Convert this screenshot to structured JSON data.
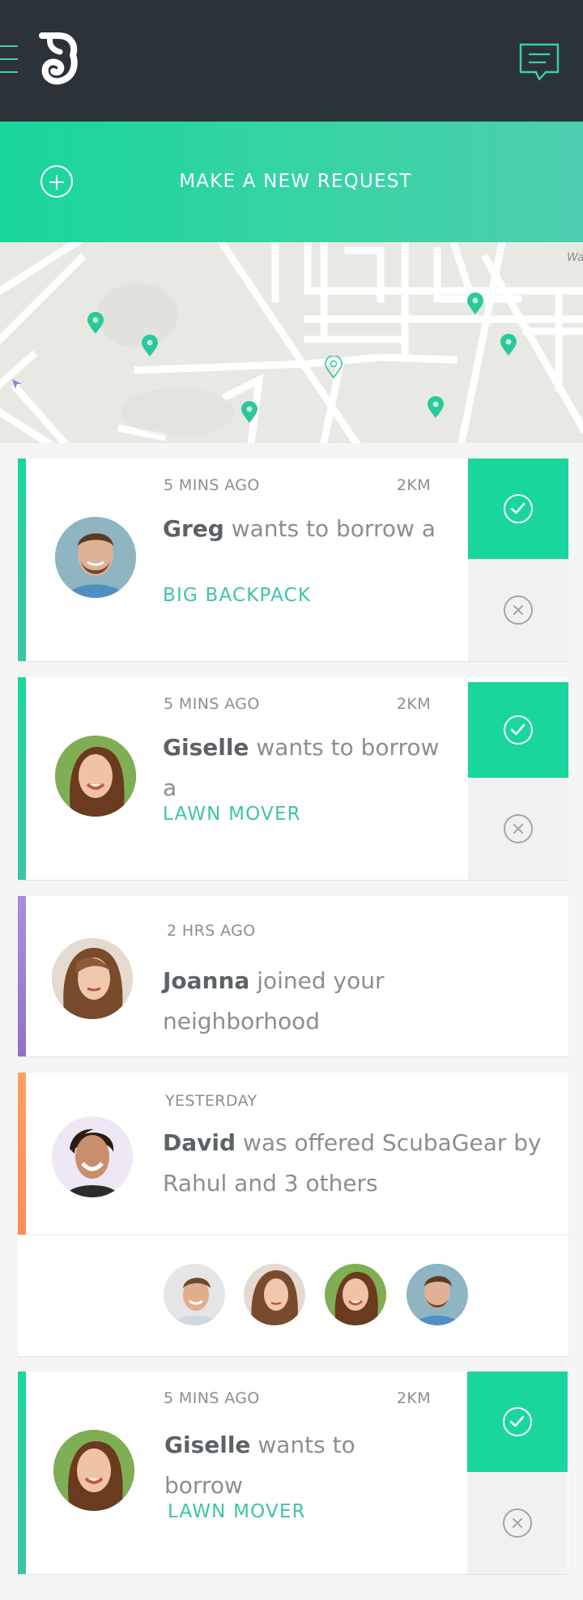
{
  "header": {
    "menu_icon": "hamburger-icon",
    "logo_icon": "logo-icon",
    "messages_icon": "chat-bubble-icon"
  },
  "new_request": {
    "icon": "plus-circle-icon",
    "label": "MAKE A NEW REQUEST"
  },
  "map": {
    "label": "Wa",
    "pin_icon": "map-pin-icon"
  },
  "feed": [
    {
      "time": "5 MINS AGO",
      "distance": "2KM",
      "name": "Greg",
      "action": "wants to borrow a",
      "item": "BIG BACKPACK"
    },
    {
      "time": "5 MINS AGO",
      "distance": "2KM",
      "name": "Giselle",
      "action": "wants to borrow a",
      "item": "LAWN MOVER"
    },
    {
      "time": "2 HRS AGO",
      "name": "Joanna",
      "action": "joined your neighborhood"
    },
    {
      "time": "YESTERDAY",
      "name": "David",
      "action_line1": "was offered ScubaGear by",
      "action_line2": "Rahul and 3 others"
    },
    {
      "time": "5 MINS AGO",
      "distance": "2KM",
      "name": "Giselle",
      "action": "wants to borrow",
      "item": "LAWN MOVER"
    }
  ],
  "colors": {
    "accent": "#19d69d",
    "header_bg": "#2b3339",
    "stripe_purple": "#9b7fd0",
    "stripe_orange": "#ff9b5c",
    "item_text": "#3ec4a5"
  }
}
